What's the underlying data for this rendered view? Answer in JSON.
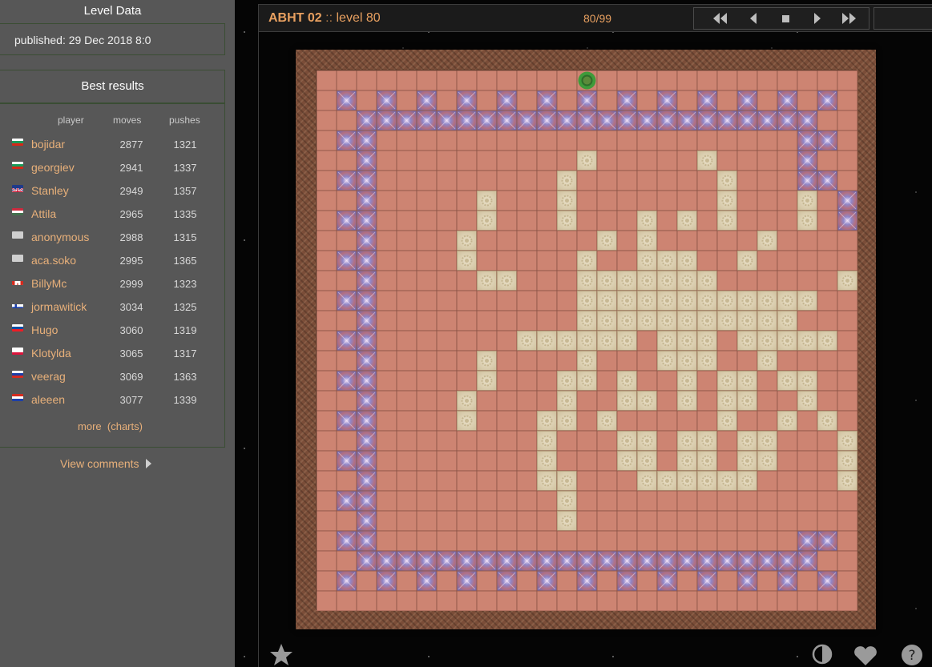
{
  "sidebar": {
    "level_data_title": "Level Data",
    "published_label": "published:",
    "published_value": "29 Dec 2018 8:0",
    "best_results_title": "Best results",
    "columns": {
      "player": "player",
      "moves": "moves",
      "pushes": "pushes"
    },
    "results": [
      {
        "player": "bojidar",
        "moves": "2877",
        "pushes": "1321",
        "flag": "bg"
      },
      {
        "player": "georgiev",
        "moves": "2941",
        "pushes": "1337",
        "flag": "bg"
      },
      {
        "player": "Stanley",
        "moves": "2949",
        "pushes": "1357",
        "flag": "gb"
      },
      {
        "player": "Attila",
        "moves": "2965",
        "pushes": "1335",
        "flag": "hu"
      },
      {
        "player": "anonymous",
        "moves": "2988",
        "pushes": "1315",
        "flag": "none"
      },
      {
        "player": "aca.soko",
        "moves": "2995",
        "pushes": "1365",
        "flag": "none"
      },
      {
        "player": "BillyMc",
        "moves": "2999",
        "pushes": "1323",
        "flag": "ca"
      },
      {
        "player": "jormawitick",
        "moves": "3034",
        "pushes": "1325",
        "flag": "fi"
      },
      {
        "player": "Hugo",
        "moves": "3060",
        "pushes": "1319",
        "flag": "sk"
      },
      {
        "player": "Klotylda",
        "moves": "3065",
        "pushes": "1317",
        "flag": "pl"
      },
      {
        "player": "veerag",
        "moves": "3069",
        "pushes": "1363",
        "flag": "ru"
      },
      {
        "player": "aleeen",
        "moves": "3077",
        "pushes": "1339",
        "flag": "hr"
      }
    ],
    "more_label": "more",
    "charts_label": "(charts)",
    "view_comments_label": "View comments"
  },
  "header": {
    "set_name": "ABHT 02",
    "separator": "::",
    "level_label": "level 80",
    "level_counter": "80/99"
  },
  "navigation": [
    "first-level-icon",
    "previous-level-icon",
    "stop-icon",
    "next-level-icon",
    "last-level-icon"
  ],
  "board": {
    "rows": [
      "...........................",
      ".*.*.*.*.*.*.*.*.*.*.*.*.*.",
      "..xxxxxxxxxxxxxxxxxxxxxxx..",
      ".*x.....................x*.",
      "..x..........B.....B....x..",
      ".*x.........B.......B...x*.",
      "..x.....B...B.......B...B.x..",
      ".*x.....B...B...B.B.B...B.x*.",
      "..x....B......B.B.....B....x..",
      ".*x....B.....B..BBB..B.....Bx*.",
      "..x.....BB...BBBBBBB......BBx..",
      ".*x..........BBBBBBBBBBBB...x*.",
      "..x..........BBBBBBBBBBB....x..",
      ".*x.......BBBBBB.BBB.BBBBB..x*.",
      "..x.....B....B...BBB..B.....Bx..",
      ".*x.....B...BB.B..B.BB.BB...Bx*.",
      "..x....B....B..BB.B.BB..B....Bx..",
      ".*x....B...BB.B.....B..B.B...Bx*.",
      "..x........B...BB.BB.BB...B..x..",
      ".*x........B...BB.BB.BB...B..x*.",
      "..x........BB...BBBBBB....BB.x..",
      ".*x.........B...............B..x*.",
      "..x.........B...............B..x..",
      ".*x.....................x*.",
      "..xxxxxxxxxxxxxxxxxxxxxxx..",
      ".*.*.*.*.*.*.*.*.*.*.*.*.*.",
      "..........................."
    ],
    "player_position": {
      "row": 0,
      "col": 13
    }
  },
  "bottom_icons": [
    "star-icon",
    "contrast-icon",
    "heart-icon",
    "help-icon"
  ]
}
